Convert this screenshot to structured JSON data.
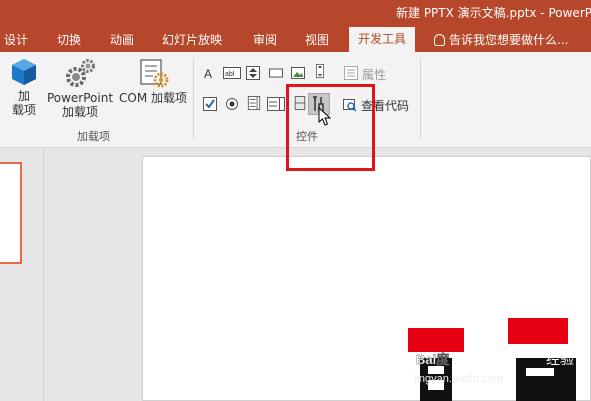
{
  "window": {
    "title": "新建 PPTX 演示文稿.pptx - PowerPoint"
  },
  "tabs": [
    "设计",
    "切换",
    "动画",
    "幻灯片放映",
    "审阅",
    "视图",
    "开发工具"
  ],
  "active_tab": "开发工具",
  "tell_me": "告诉我您想要做什么...",
  "ribbon": {
    "addins_group": {
      "label": "加载项",
      "buttons": [
        {
          "line1": "加",
          "line2": "载项",
          "icon": "addins-icon"
        },
        {
          "line1": "PowerPoint",
          "line2": "加载项",
          "icon": "gears-icon"
        },
        {
          "line1": "COM 加载项",
          "line2": "",
          "icon": "com-addins-icon"
        }
      ]
    },
    "controls_group": {
      "label": "控件",
      "properties": "属性",
      "view_code": "查看代码"
    }
  },
  "watermark": {
    "big": "百度",
    "brand": "Bai度",
    "jingyan": "经验",
    "url": "jingyan.baidu.com"
  },
  "colors": {
    "accent": "#b7472a",
    "highlight": "#e0151a"
  }
}
